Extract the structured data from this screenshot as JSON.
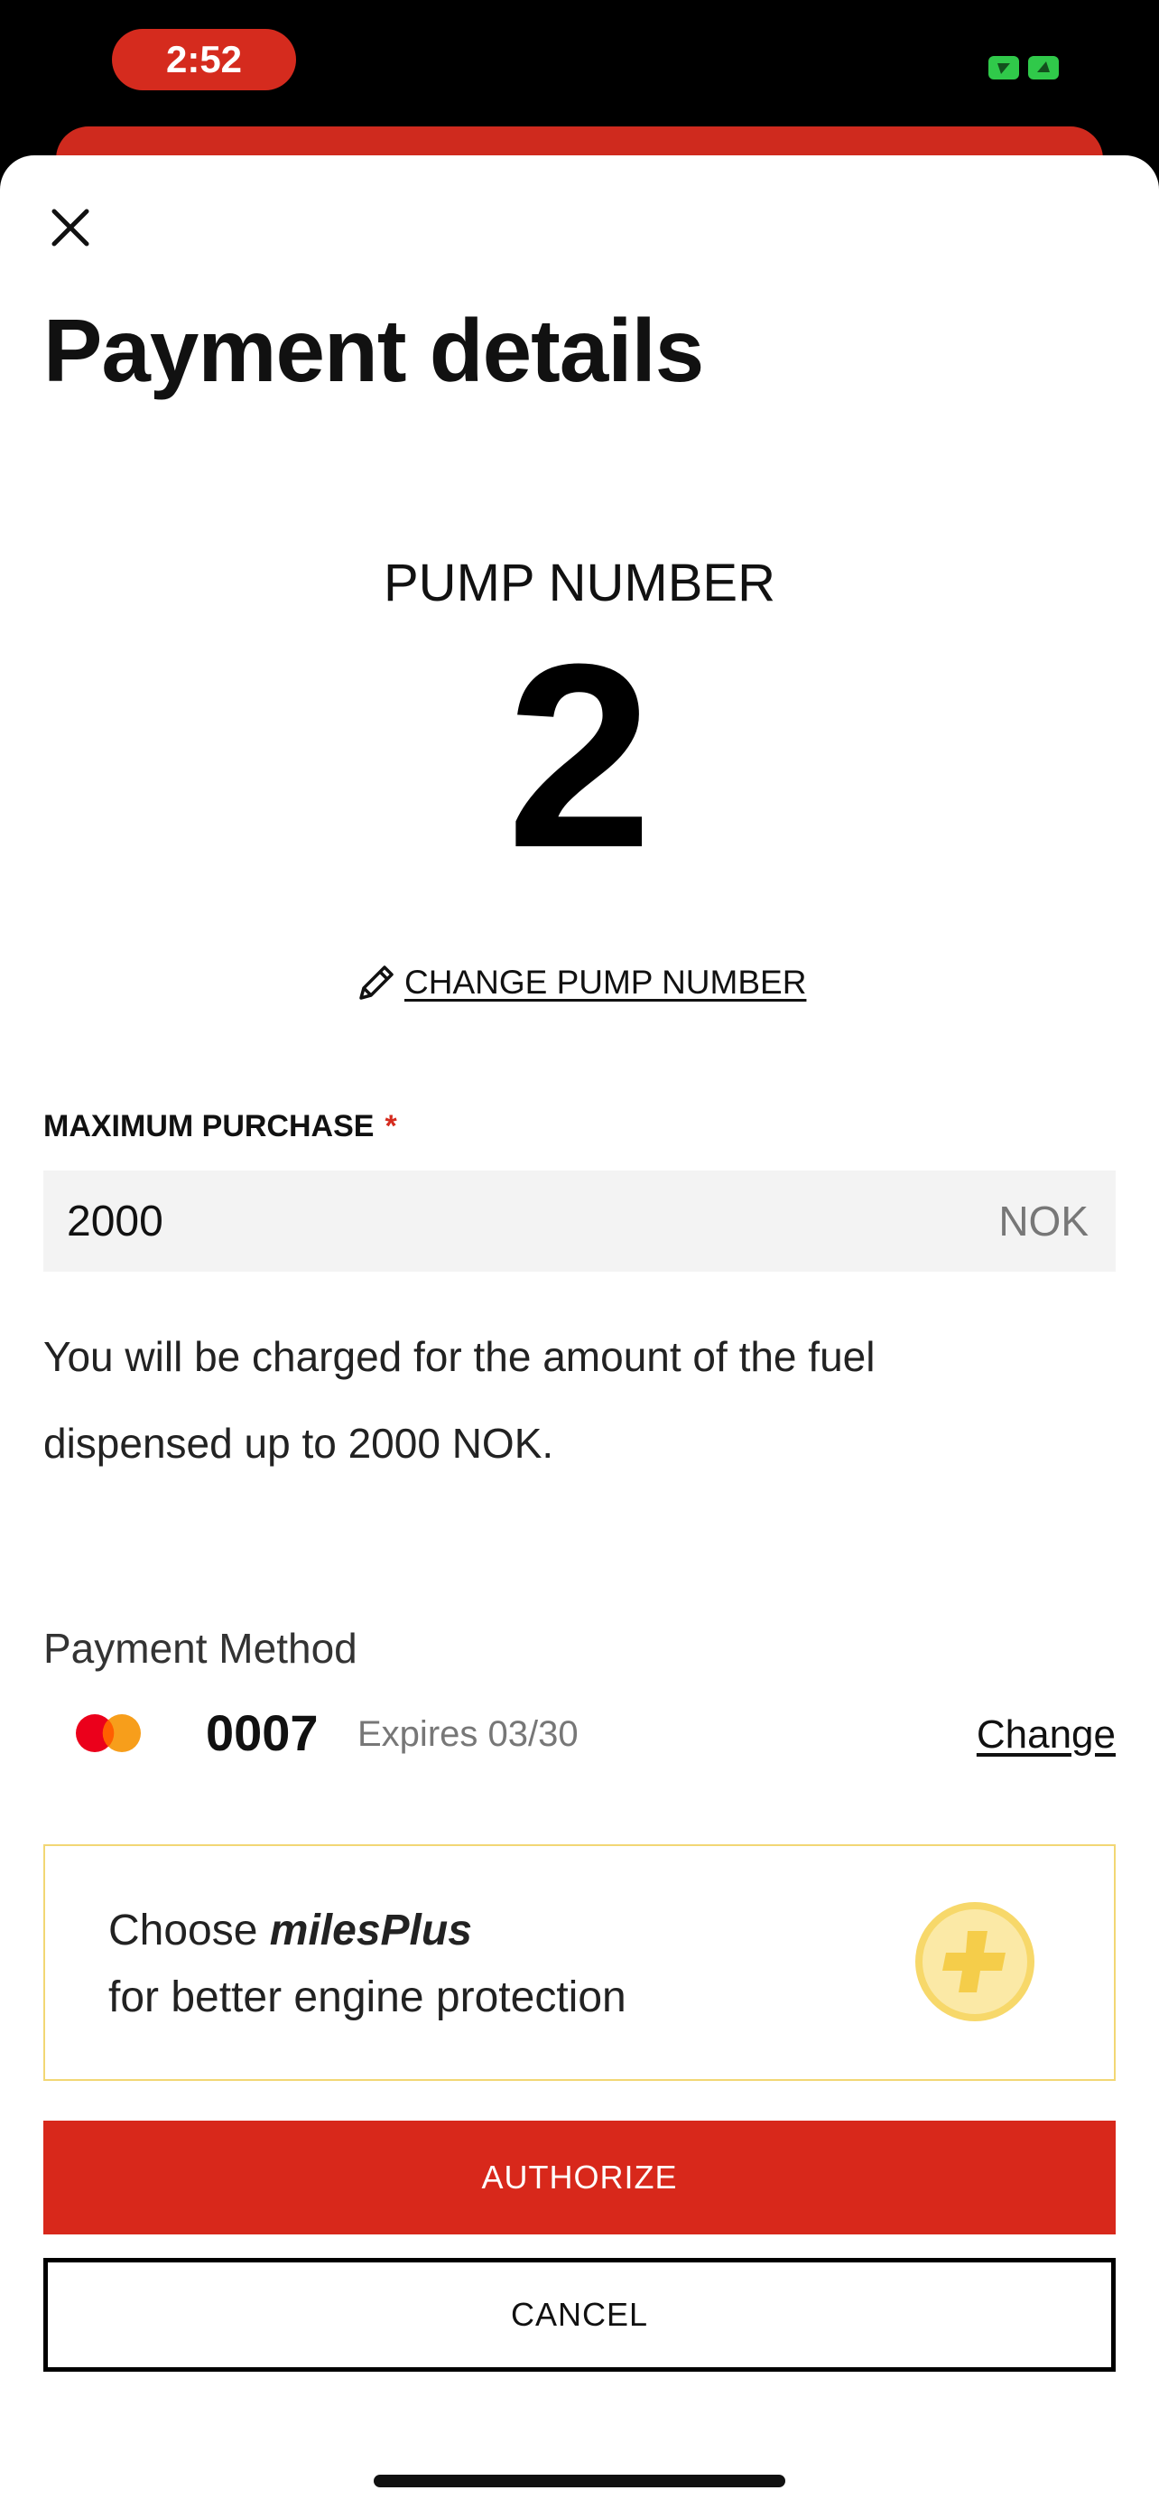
{
  "status_bar": {
    "time": "2:52"
  },
  "header": {
    "close_icon": "close-icon",
    "title": "Payment details"
  },
  "pump": {
    "label": "PUMP NUMBER",
    "number": "2",
    "change_label": "CHANGE PUMP NUMBER",
    "change_icon": "pencil-icon"
  },
  "max_purchase": {
    "label": "MAXIMUM PURCHASE",
    "required_mark": "*",
    "value": "2000",
    "currency": "NOK"
  },
  "info": {
    "line1": "You will be charged for the amount of the fuel",
    "line2": "dispensed up to 2000 NOK."
  },
  "payment_method": {
    "title": "Payment Method",
    "card_icon": "mastercard-icon",
    "card_last4": "0007",
    "expiry": "Expires 03/30",
    "change_label": "Change"
  },
  "promo": {
    "prefix": "Choose ",
    "brand": "milesPlus",
    "line2": "for better engine protection",
    "icon": "plus-circle-icon"
  },
  "actions": {
    "authorize": "AUTHORIZE",
    "cancel": "CANCEL"
  },
  "colors": {
    "accent": "#d8281b",
    "promo_border": "#f2d774",
    "promo_icon": "#f7d86a"
  }
}
